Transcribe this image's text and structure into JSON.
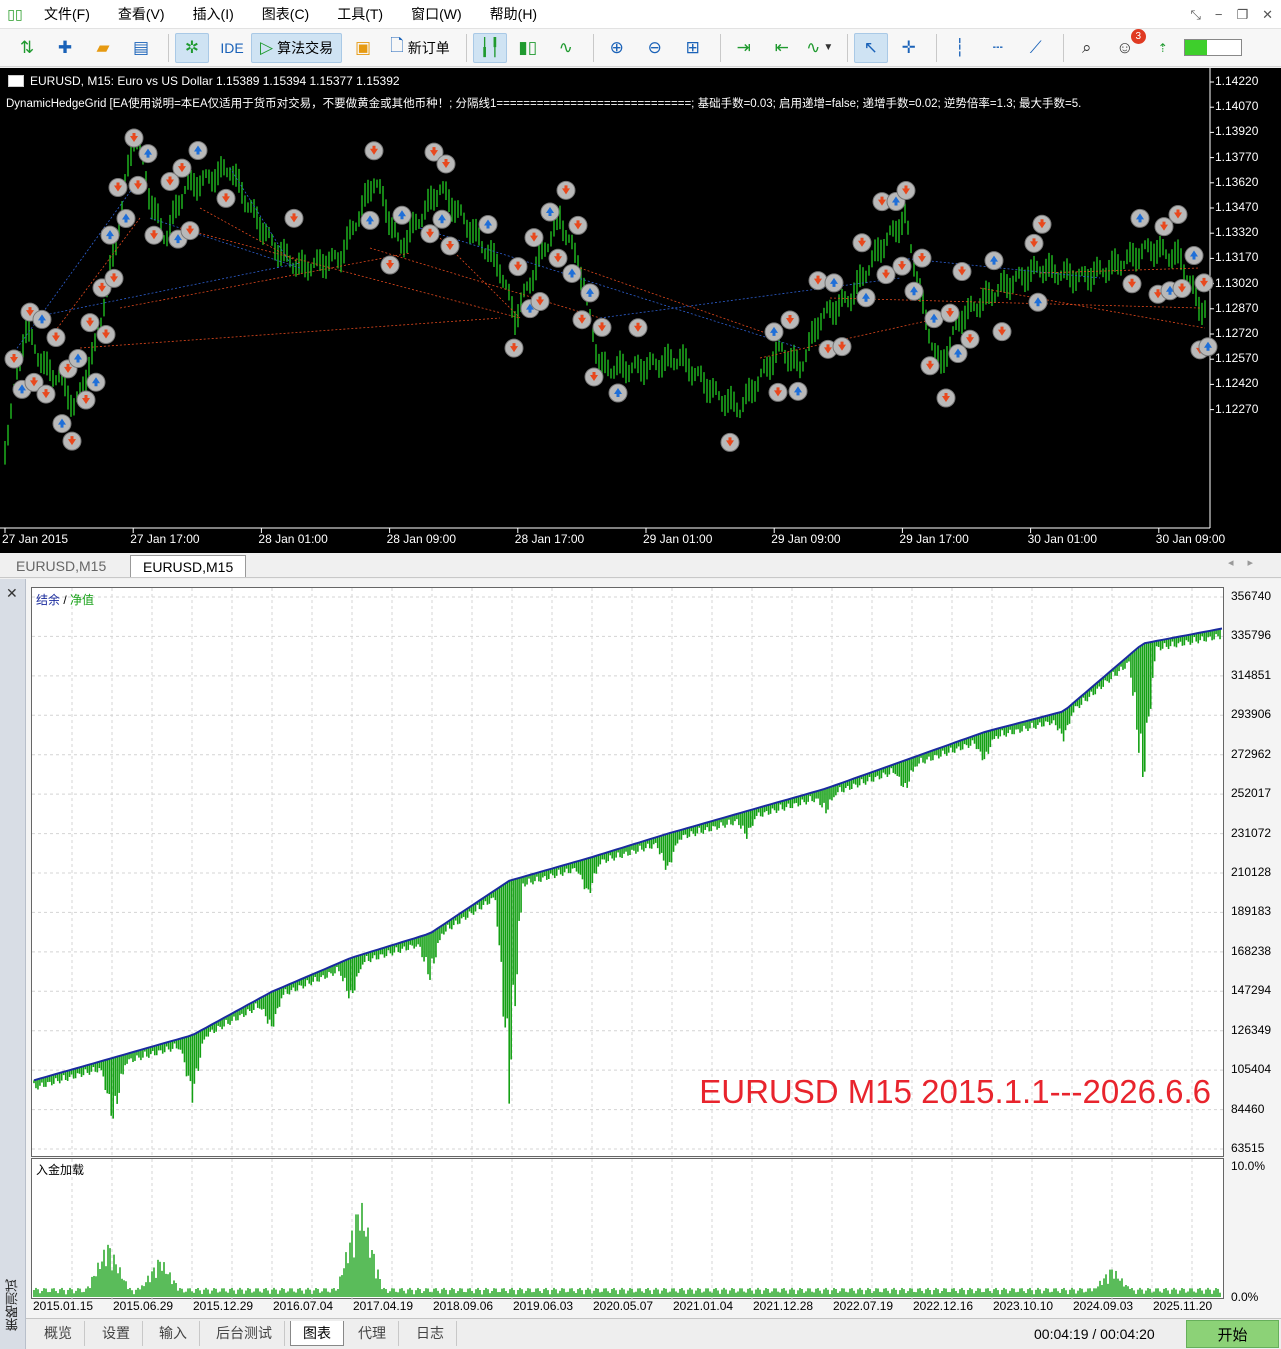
{
  "app": {
    "menu": [
      "文件(F)",
      "查看(V)",
      "插入(I)",
      "图表(C)",
      "工具(T)",
      "窗口(W)",
      "帮助(H)"
    ]
  },
  "toolbar": {
    "ide_label": "IDE",
    "algo_label": "算法交易",
    "new_order_label": "新订单",
    "notifications": "3",
    "level_fill_fraction": 0.4
  },
  "price_chart": {
    "header": "EURUSD, M15:  Euro vs US Dollar  1.15389 1.15394 1.15377 1.15392",
    "ea_info": "DynamicHedgeGrid [EA使用说明=本EA仅适用于货币对交易，不要做黄金或其他币种！; 分隔线1=============================; 基础手数=0.03; 启用递增=false; 递增手数=0.02; 逆势倍率=1.3; 最大手数=5.",
    "price_labels": [
      "1.14220",
      "1.14070",
      "1.13920",
      "1.13770",
      "1.13620",
      "1.13470",
      "1.13320",
      "1.13170",
      "1.13020",
      "1.12870",
      "1.12720",
      "1.12570",
      "1.12420",
      "1.12270"
    ],
    "time_labels": [
      "27 Jan 2015",
      "27 Jan 17:00",
      "28 Jan 01:00",
      "28 Jan 09:00",
      "28 Jan 17:00",
      "29 Jan 01:00",
      "29 Jan 09:00",
      "29 Jan 17:00",
      "30 Jan 01:00",
      "30 Jan 09:00"
    ]
  },
  "chart_tabs": [
    "EURUSD,M15",
    "EURUSD,M15"
  ],
  "tester": {
    "vertical_label": "策略测试",
    "legend_balance": "结余",
    "legend_sep": " / ",
    "legend_equity": "净值",
    "watermark": "EURUSD M15 2015.1.1---2026.6.6",
    "load_title": "入金加载",
    "y_labels": [
      "356740",
      "335796",
      "314851",
      "293906",
      "272962",
      "252017",
      "231072",
      "210128",
      "189183",
      "168238",
      "147294",
      "126349",
      "105404",
      "84460",
      "63515"
    ],
    "load_labels": [
      "10.0%",
      "0.0%"
    ],
    "date_labels": [
      "2015.01.15",
      "2015.06.29",
      "2015.12.29",
      "2016.07.04",
      "2017.04.19",
      "2018.09.06",
      "2019.06.03",
      "2020.05.07",
      "2021.01.04",
      "2021.12.28",
      "2022.07.19",
      "2022.12.16",
      "2023.10.10",
      "2024.09.03",
      "2025.11.20"
    ],
    "tabs": [
      "概览",
      "设置",
      "输入",
      "后台测试",
      "图表",
      "代理",
      "日志"
    ],
    "active_tab": 4,
    "timer": "00:04:19 / 00:04:20",
    "start_label": "开始"
  },
  "colors": {
    "balance": "#1a2b9e",
    "equity": "#14a014",
    "candle": "#22cc22",
    "sell_arrow": "#e8481d",
    "buy_arrow": "#1f6fd8",
    "watermark": "#e8242d"
  },
  "chart_data": [
    {
      "type": "line",
      "title": "",
      "series": [
        {
          "name": "结余",
          "values": [
            100000,
            112000,
            124000,
            147000,
            165000,
            178000,
            206000,
            218000,
            231000,
            243000,
            255000,
            270000,
            285000,
            296000,
            332000,
            340000
          ]
        },
        {
          "name": "净值",
          "values": [
            98000,
            76000,
            88000,
            125000,
            140000,
            152000,
            85000,
            196000,
            209000,
            228000,
            241000,
            252000,
            268000,
            280000,
            252000,
            335000
          ]
        }
      ],
      "x": [
        "2015.01.15",
        "2015.06.29",
        "2015.12.29",
        "2016.07.04",
        "2017.04.19",
        "2018.09.06",
        "2019.06.03",
        "2020.05.07",
        "2021.01.04",
        "2021.12.28",
        "2022.07.19",
        "2022.12.16",
        "2023.10.10",
        "2024.09.03",
        "2025.11.20"
      ],
      "ylim": [
        63515,
        356740
      ],
      "legend": "top-left",
      "grid": true
    },
    {
      "type": "bar",
      "title": "入金加载",
      "ylim": [
        0,
        10
      ],
      "peaks": [
        {
          "x": "2015.06.29",
          "value": 4.4
        },
        {
          "x": "2015.12.29",
          "value": 3.2
        },
        {
          "x": "2017.04.19",
          "value": 7.9
        },
        {
          "x": "2024.09.03",
          "value": 2.4
        }
      ]
    }
  ]
}
